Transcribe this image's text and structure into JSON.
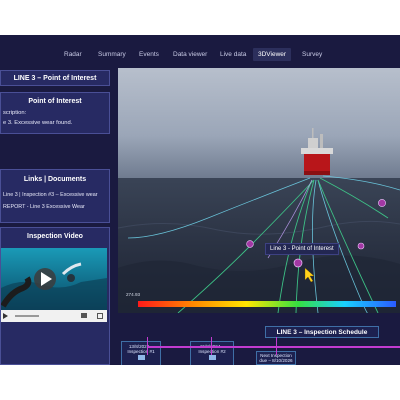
{
  "nav": {
    "tabs": [
      {
        "label": "Radar"
      },
      {
        "label": "Summary"
      },
      {
        "label": "Events"
      },
      {
        "label": "Data viewer"
      },
      {
        "label": "Live data"
      },
      {
        "label": "3DViewer"
      },
      {
        "label": "Survey"
      }
    ],
    "active_tab": "3DViewer"
  },
  "left_panel": {
    "title": "LINE 3 – Point of Interest",
    "poi": {
      "heading": "Point of Interest",
      "line1": "scription:",
      "line2": "e 3. Excessive wear found."
    },
    "links": {
      "heading": "Links | Documents",
      "items": [
        "Line 3 | Inspection #3 – Excessive wear",
        "REPORT - Line 3 Excessive Wear"
      ]
    },
    "video": {
      "heading": "Inspection Video"
    }
  },
  "viewer": {
    "label": "Line 3 -  Point of Interest",
    "scale_value": "274.93",
    "colors": {
      "sky_top": "#9aa4b7",
      "sea": "#2c3445",
      "hull": "#b8161a",
      "marker": "#a238a4",
      "line_green": "#3ec98a",
      "line_blue": "#6fd1e8",
      "cursor": "#ffd11a"
    }
  },
  "schedule": {
    "title": "LINE 3 – Inspection Schedule",
    "events": [
      {
        "date": "13/8/2022 –",
        "label": "Inspection #1"
      },
      {
        "date": "15/8/2024 –",
        "label": "Inspection #2"
      },
      {
        "date": "Next Inspection",
        "label": "due – 8/10/2026"
      }
    ],
    "timeline_color": "#c23bd0"
  }
}
